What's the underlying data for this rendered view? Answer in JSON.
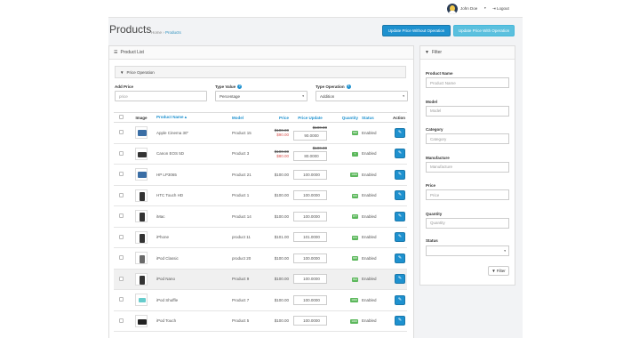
{
  "header": {
    "user_name": "John Doe",
    "user_caret": "▾",
    "logout_label": "Logout",
    "logout_icon": "⇥"
  },
  "page": {
    "title": "Products",
    "breadcrumb": [
      "Home",
      "Products"
    ],
    "breadcrumb_sep": "›"
  },
  "actions": {
    "update_without": "Update Price Without Operation",
    "update_with": "Update Price With Operation"
  },
  "product_list": {
    "heading": "Product List",
    "heading_icon": "list-icon",
    "price_operation_heading": "Price Operation",
    "add_price_label": "Add Price",
    "add_price_placeholder": "price",
    "type_value_label": "Type Value",
    "type_value_selected": "Percentage",
    "type_operation_label": "Type Operation",
    "type_operation_selected": "Addition",
    "help_glyph": "?"
  },
  "table": {
    "columns": [
      "Image",
      "Product Name",
      "Model",
      "Price",
      "Price Update",
      "Quantity",
      "Status",
      "Action"
    ],
    "sort_indicator": "▴",
    "rows": [
      {
        "name": "Apple Cinema 30\"",
        "model": "Product 15",
        "price": "$100.00",
        "special": "$90.00",
        "pu_old": "$100.00",
        "pu_value": "90.0000",
        "qty": "990",
        "status": "Enabled",
        "icon": "monitor-thumbnail",
        "discounted": true
      },
      {
        "name": "Canon EOS 5D",
        "model": "Product 3",
        "price": "$100.00",
        "special": "$80.00",
        "pu_old": "$100.00",
        "pu_value": "80.0000",
        "qty": "7",
        "status": "Enabled",
        "icon": "camera-thumbnail",
        "discounted": true
      },
      {
        "name": "HP LP3065",
        "model": "Product 21",
        "price": "$100.00",
        "special": "",
        "pu_old": "",
        "pu_value": "100.0000",
        "qty": "1000",
        "status": "Enabled",
        "icon": "monitor-thumbnail",
        "discounted": false
      },
      {
        "name": "HTC Touch HD",
        "model": "Product 1",
        "price": "$100.00",
        "special": "",
        "pu_old": "",
        "pu_value": "100.0000",
        "qty": "939",
        "status": "Enabled",
        "icon": "phone-thumbnail",
        "discounted": false
      },
      {
        "name": "iMac",
        "model": "Product 14",
        "price": "$100.00",
        "special": "",
        "pu_old": "",
        "pu_value": "100.0000",
        "qty": "977",
        "status": "Enabled",
        "icon": "phone-thumbnail",
        "discounted": false
      },
      {
        "name": "iPhone",
        "model": "product 11",
        "price": "$101.00",
        "special": "",
        "pu_old": "",
        "pu_value": "101.0000",
        "qty": "970",
        "status": "Enabled",
        "icon": "phone-thumbnail",
        "discounted": false
      },
      {
        "name": "iPod Classic",
        "model": "product 20",
        "price": "$100.00",
        "special": "",
        "pu_old": "",
        "pu_value": "100.0000",
        "qty": "995",
        "status": "Enabled",
        "icon": "music-thumbnail",
        "discounted": false
      },
      {
        "name": "iPod Nano",
        "model": "Product 9",
        "price": "$100.00",
        "special": "",
        "pu_old": "",
        "pu_value": "100.0000",
        "qty": "994",
        "status": "Enabled",
        "icon": "phone-thumbnail",
        "discounted": false
      },
      {
        "name": "iPod Shuffle",
        "model": "Product 7",
        "price": "$100.00",
        "special": "",
        "pu_old": "",
        "pu_value": "100.0000",
        "qty": "1000",
        "status": "Enabled",
        "icon": "shuffle-thumbnail",
        "discounted": false
      },
      {
        "name": "iPod Touch",
        "model": "Product 5",
        "price": "$100.00",
        "special": "",
        "pu_old": "",
        "pu_value": "100.0000",
        "qty": "1000",
        "status": "Enabled",
        "icon": "touch-thumbnail",
        "discounted": false
      }
    ],
    "highlighted_row": 7
  },
  "filter": {
    "heading": "Filter",
    "heading_icon": "filter-icon",
    "fields": [
      {
        "label": "Product Name",
        "placeholder": "Product Name"
      },
      {
        "label": "Model",
        "placeholder": "Model"
      },
      {
        "label": "Category",
        "placeholder": "Category"
      },
      {
        "label": "Manufacture",
        "placeholder": "Manufacture"
      },
      {
        "label": "Price",
        "placeholder": "Price"
      },
      {
        "label": "Quantity",
        "placeholder": "Quantity"
      }
    ],
    "status_label": "Status",
    "status_selected": "",
    "button_label": "Filter"
  },
  "colors": {
    "primary": "#1e91cf",
    "info": "#5bc0de",
    "success": "#5cb85c",
    "danger": "#d9534f"
  }
}
